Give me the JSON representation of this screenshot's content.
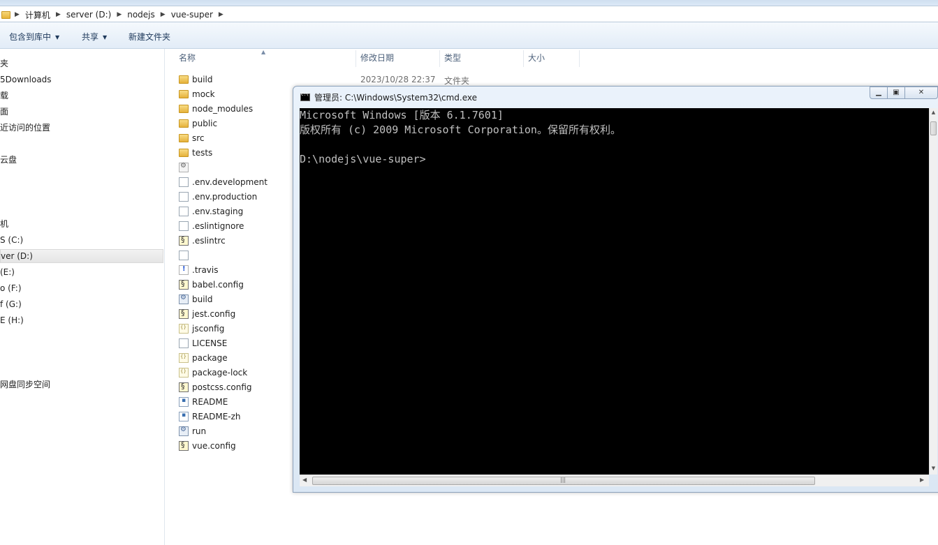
{
  "address_bar": {
    "crumbs": [
      "计算机",
      "server (D:)",
      "nodejs",
      "vue-super"
    ]
  },
  "toolbar": {
    "include_library": "包含到库中",
    "share": "共享",
    "new_folder": "新建文件夹"
  },
  "nav": {
    "items": [
      "夹",
      "5Downloads",
      "载",
      "面",
      "近访问的位置",
      "云盘",
      "机",
      "S (C:)",
      "ver (D:)",
      "(E:)",
      "o (F:)",
      "f (G:)",
      "E (H:)",
      "网盘同步空间"
    ]
  },
  "columns": {
    "name": "名称",
    "modified": "修改日期",
    "type": "类型",
    "size": "大小"
  },
  "files": [
    {
      "name": "build",
      "icon": "folder-icon"
    },
    {
      "name": "mock",
      "icon": "folder-icon"
    },
    {
      "name": "node_modules",
      "icon": "folder-icon"
    },
    {
      "name": "public",
      "icon": "folder-icon"
    },
    {
      "name": "src",
      "icon": "folder-icon"
    },
    {
      "name": "tests",
      "icon": "folder-icon"
    },
    {
      "name": "",
      "icon": "settings-file-icon"
    },
    {
      "name": ".env.development",
      "icon": "blank-file-icon"
    },
    {
      "name": ".env.production",
      "icon": "blank-file-icon"
    },
    {
      "name": ".env.staging",
      "icon": "blank-file-icon"
    },
    {
      "name": ".eslintignore",
      "icon": "blank-file-icon"
    },
    {
      "name": ".eslintrc",
      "icon": "script-file-icon"
    },
    {
      "name": "",
      "icon": "blank-file-icon"
    },
    {
      "name": ".travis",
      "icon": "yml-file-icon"
    },
    {
      "name": "babel.config",
      "icon": "script-file-icon"
    },
    {
      "name": "build",
      "icon": "batch-file-icon"
    },
    {
      "name": "jest.config",
      "icon": "script-file-icon"
    },
    {
      "name": "jsconfig",
      "icon": "json-file-icon"
    },
    {
      "name": "LICENSE",
      "icon": "blank-file-icon"
    },
    {
      "name": "package",
      "icon": "json-file-icon"
    },
    {
      "name": "package-lock",
      "icon": "json-file-icon"
    },
    {
      "name": "postcss.config",
      "icon": "script-file-icon"
    },
    {
      "name": "README",
      "icon": "markdown-file-icon"
    },
    {
      "name": "README-zh",
      "icon": "markdown-file-icon"
    },
    {
      "name": "run",
      "icon": "batch-file-icon"
    },
    {
      "name": "vue.config",
      "icon": "script-file-icon"
    }
  ],
  "first_row_meta": {
    "modified": "2023/10/28 22:37",
    "type": "文件夹"
  },
  "cmd": {
    "title": "管理员: C:\\Windows\\System32\\cmd.exe",
    "lines": [
      "Microsoft Windows [版本 6.1.7601]",
      "版权所有 (c) 2009 Microsoft Corporation。保留所有权利。",
      "",
      "D:\\nodejs\\vue-super>"
    ],
    "colors": {
      "background": "#000000",
      "text": "#c0c0c0"
    }
  }
}
